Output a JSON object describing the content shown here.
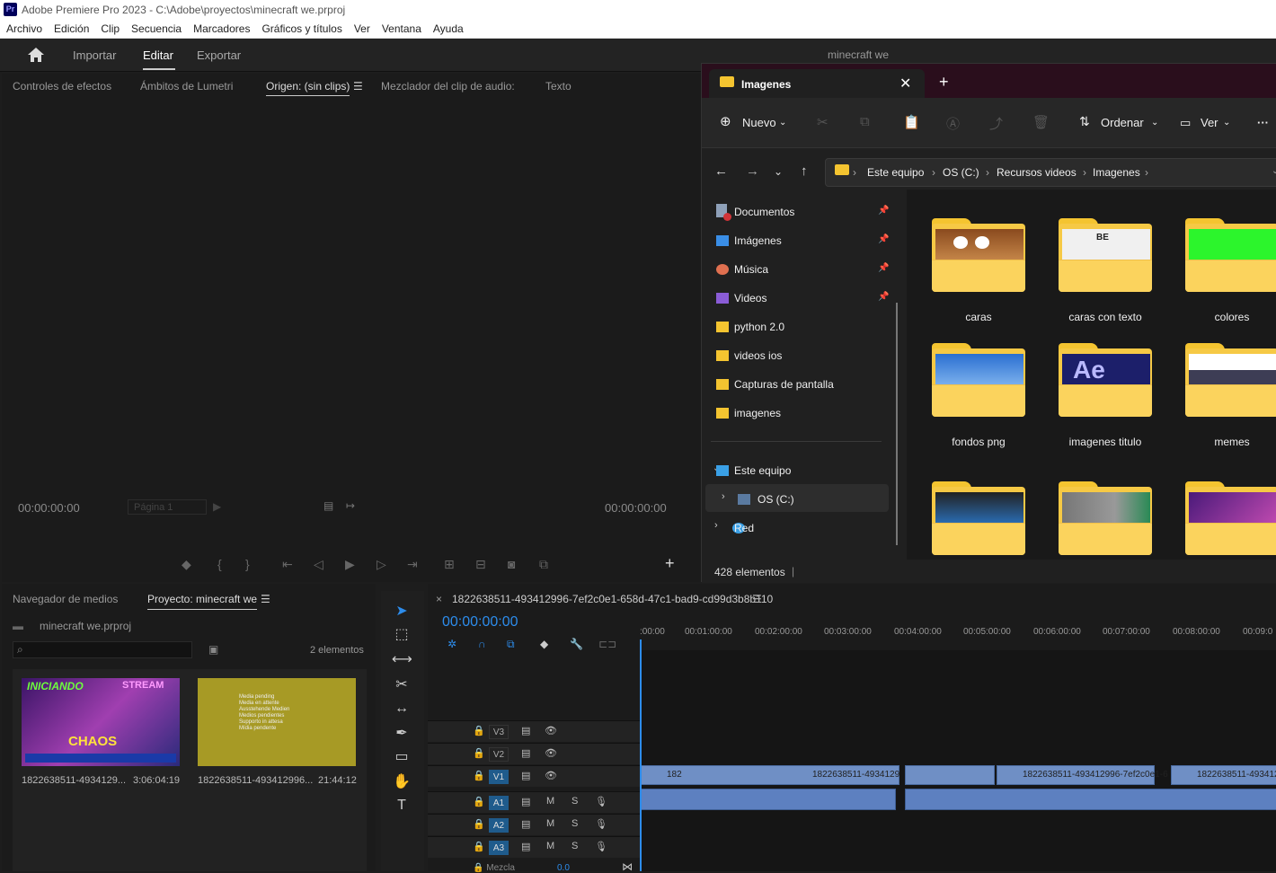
{
  "window": {
    "title": "Adobe Premiere Pro 2023 - C:\\Adobe\\proyectos\\minecraft we.prproj",
    "app_icon": "Pr"
  },
  "menu": [
    "Archivo",
    "Edición",
    "Clip",
    "Secuencia",
    "Marcadores",
    "Gráficos y títulos",
    "Ver",
    "Ventana",
    "Ayuda"
  ],
  "workspace": {
    "tabs": [
      "Importar",
      "Editar",
      "Exportar"
    ],
    "active": "Editar",
    "project_name": "minecraft we"
  },
  "source_panel": {
    "tabs": [
      "Controles de efectos",
      "Ámbitos de Lumetri",
      "Origen: (sin clips)",
      "Mezclador del clip de audio:",
      "Texto"
    ],
    "active": "Origen: (sin clips)",
    "tc_left": "00:00:00:00",
    "tc_right": "00:00:00:00",
    "page": "Página 1"
  },
  "project_panel": {
    "tabs": [
      "Navegador de medios",
      "Proyecto: minecraft we"
    ],
    "active": "Proyecto: minecraft we",
    "file": "minecraft we.prproj",
    "count": "2 elementos",
    "items": [
      {
        "name": "1822638511-4934129...",
        "duration": "3:06:04:19",
        "thumb_text": [
          "INICIANDO",
          "STREAM",
          "CHAOS"
        ]
      },
      {
        "name": "1822638511-493412996...",
        "duration": "21:44:12",
        "thumb_text": [
          "Media pending",
          "Media en attente",
          "Ausstehende Medien",
          "Medios pendientes",
          "Supporto in attesa",
          "Mídia pendente"
        ]
      }
    ]
  },
  "timeline": {
    "sequence": "1822638511-493412996-7ef2c0e1-658d-47c1-bad9-cd99d3b8b110",
    "timecode": "00:00:00:00",
    "ruler": [
      ":00:00",
      "00:01:00:00",
      "00:02:00:00",
      "00:03:00:00",
      "00:04:00:00",
      "00:05:00:00",
      "00:06:00:00",
      "00:07:00:00",
      "00:08:00:00",
      "00:09:0"
    ],
    "tracks": [
      "V3",
      "V2",
      "V1",
      "A1",
      "A2",
      "A3"
    ],
    "mix_label": "Mezcla",
    "mix_value": "0.0",
    "clips": [
      "182",
      "1822638511-4934129",
      "1822638511-493412996-7ef2c0e1-6",
      "1822638511-4934129"
    ]
  },
  "explorer": {
    "tab": "Imagenes",
    "toolbar": {
      "new": "Nuevo",
      "sort": "Ordenar",
      "view": "Ver"
    },
    "path": [
      "Este equipo",
      "OS (C:)",
      "Recursos videos",
      "Imagenes"
    ],
    "sidebar": [
      "Documentos",
      "Imágenes",
      "Música",
      "Videos",
      "python 2.0",
      "videos ios",
      "Capturas de pantalla",
      "imagenes",
      "Este equipo",
      "OS (C:)",
      "Red"
    ],
    "folders": [
      "caras",
      "caras con texto",
      "colores",
      "fondos png",
      "imagenes titulo",
      "memes",
      "",
      "",
      ""
    ],
    "folder_overlay": [
      "BE",
      "Ae"
    ],
    "status": "428 elementos"
  }
}
